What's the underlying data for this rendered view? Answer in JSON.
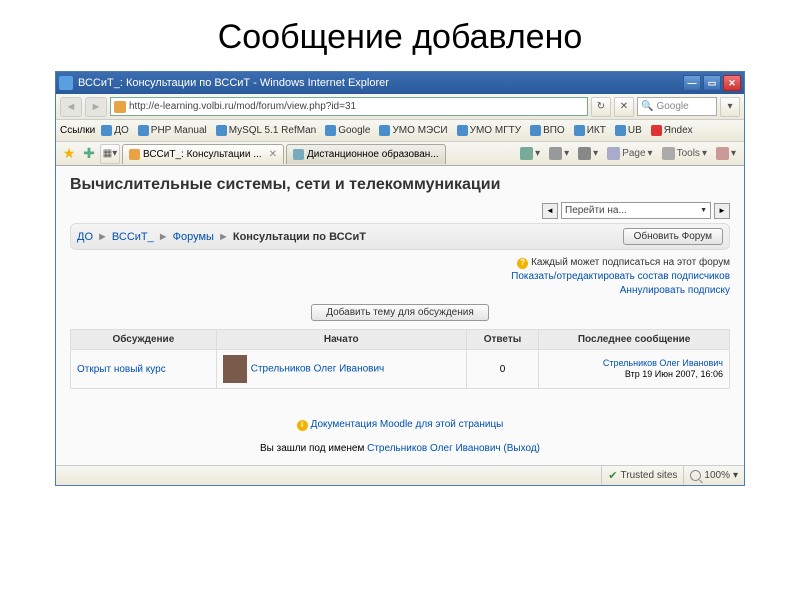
{
  "slide": {
    "title": "Сообщение добавлено"
  },
  "window": {
    "title": "ВССиТ_: Консультации по ВССиТ - Windows Internet Explorer",
    "url": "http://e-learning.volbi.ru/mod/forum/view.php?id=31",
    "search_placeholder": "Google"
  },
  "links_bar": {
    "label": "Ссылки",
    "items": [
      "ДО",
      "PHP Manual",
      "MySQL 5.1 RefMan",
      "Google",
      "УМО МЭСИ",
      "УМО МГТУ",
      "ВПО",
      "ИКТ",
      "UB",
      "Яndex"
    ]
  },
  "tabs": [
    {
      "label": "ВССиТ_: Консультации ..."
    },
    {
      "label": "Дистанционное образован..."
    }
  ],
  "toolbar_right": [
    "Page",
    "Tools"
  ],
  "page": {
    "heading": "Вычислительные системы, сети и телекоммуникации",
    "jump_label": "Перейти на...",
    "breadcrumbs": {
      "a": "ДО",
      "b": "ВССиТ_",
      "c": "Форумы",
      "d": "Консультации по ВССиТ"
    },
    "update_btn": "Обновить Форум",
    "subscribe_text": "Каждый может подписаться на этот форум",
    "sub_link1": "Показать/отредактировать состав подписчиков",
    "sub_link2": "Аннулировать подписку",
    "add_topic": "Добавить тему для обсуждения",
    "table": {
      "h1": "Обсуждение",
      "h2": "Начато",
      "h3": "Ответы",
      "h4": "Последнее сообщение",
      "topic": "Открыт новый курс",
      "author": "Стрельников Олег Иванович",
      "replies": "0",
      "last_author": "Стрельников Олег Иванович",
      "last_date": "Втр 19 Июн 2007, 16:06"
    },
    "doc_link": "Документация Moodle для этой страницы",
    "logged_prefix": "Вы зашли под именем ",
    "logged_user": "Стрельников Олег Иванович",
    "logout": " (Выход)"
  },
  "status": {
    "trusted": "Trusted sites",
    "zoom": "100%"
  }
}
